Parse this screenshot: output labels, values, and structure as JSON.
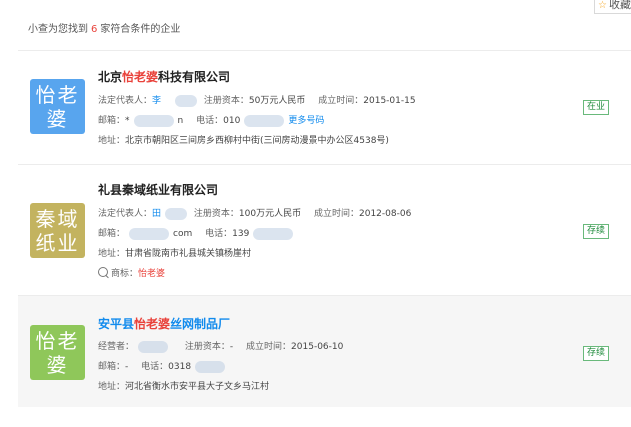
{
  "summary": {
    "prefix": "小查为您找到",
    "count": "6",
    "suffix": "家符合条件的企业"
  },
  "collect_label": "收藏",
  "companies": [
    {
      "logo": "怡老婆",
      "logo_color": "#58a5ee",
      "name_parts": [
        "北京",
        "怡老婆",
        "科技有限公司"
      ],
      "legal_label": "法定代表人：",
      "legal_value": "李",
      "capital_label": "注册资本：",
      "capital_value": "50万元人民币",
      "date_label": "成立时间：",
      "date_value": "2015-01-15",
      "email_label": "邮箱：",
      "email_value": "*",
      "email_tail": "n",
      "phone_label": "电话：",
      "phone_value": "010",
      "more_phone": "更多号码",
      "address_label": "地址：",
      "address_value": "北京市朝阳区三间房乡西柳村中街(三间房动漫景中办公区4538号)",
      "status": "在业"
    },
    {
      "logo": "秦域纸业",
      "logo_color": "#c3b35f",
      "name": "礼县秦域纸业有限公司",
      "legal_label": "法定代表人：",
      "legal_value": "田",
      "capital_label": "注册资本：",
      "capital_value": "100万元人民币",
      "date_label": "成立时间：",
      "date_value": "2012-08-06",
      "email_label": "邮箱：",
      "email_value": "com",
      "phone_label": "电话：",
      "phone_value": "139",
      "address_label": "地址：",
      "address_value": "甘肃省陇南市礼县城关镇杨崖村",
      "trademark_label": "商标：",
      "trademark_value": "怡老婆",
      "status": "存续"
    },
    {
      "logo": "怡老婆",
      "logo_color": "#8fc75a",
      "name_parts": [
        "安平县",
        "怡老婆",
        "丝网制品厂"
      ],
      "legal_label": "经营者：",
      "legal_value": "",
      "capital_label": "注册资本：",
      "capital_value": "-",
      "date_label": "成立时间：",
      "date_value": "2015-06-10",
      "email_label": "邮箱：",
      "email_value": "-",
      "phone_label": "电话：",
      "phone_value": "0318",
      "address_label": "地址：",
      "address_value": "河北省衡水市安平县大子文乡马江村",
      "status": "存续"
    }
  ]
}
